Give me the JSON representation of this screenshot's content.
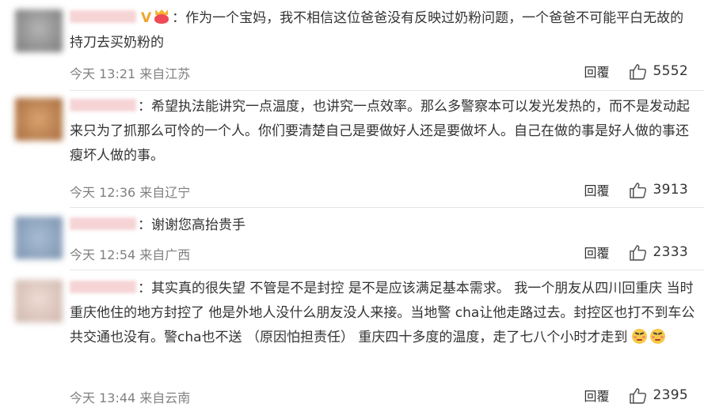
{
  "comments": [
    {
      "avatar_color": "#8f8f8f",
      "text": "：作为一个宝妈，我不相信这位爸爸没有反映过奶粉问题，一个爸爸不可能平白无故的持刀去买奶粉的",
      "time": "今天 13:21 来自江苏",
      "reply_label": "回覆",
      "likes": "5552",
      "badges": {
        "verified": "V",
        "crown": "crown-face-badge-icon"
      }
    },
    {
      "avatar_color": "#c98a55",
      "text": "：希望执法能讲究一点温度，也讲究一点效率。那么多警察本可以发光发热的，而不是发动起来只为了抓那么可怜的一个人。你们要清楚自己是要做好人还是要做坏人。自己在做的事是好人做的事还瘦坏人做的事。",
      "time": "今天 12:36 来自辽宁",
      "reply_label": "回覆",
      "likes": "3913"
    },
    {
      "avatar_color": "#8fa7c2",
      "text": "：谢谢您高抬贵手",
      "time": "今天 12:54 来自广西",
      "reply_label": "回覆",
      "likes": "2333"
    },
    {
      "avatar_color": "#e2cdc6",
      "text": "：其实真的很失望 不管是不是封控 是不是应该满足基本需求。 我一个朋友从四川回重庆 当时重庆他住的地方封控了 他是外地人没什么朋友没人来接。当地警 cha让他走路过去。封控区也打不到车公共交通也没有。警cha也不送 （原因怕担责任） 重庆四十多度的温度，走了七八个小时才走到",
      "emojis": [
        "sad-emoji-icon",
        "sad-emoji-icon"
      ],
      "time": "今天 13:44 来自云南",
      "reply_label": "回覆",
      "likes": "2395"
    }
  ],
  "colors": {
    "text": "#333333",
    "meta": "#808080",
    "divider": "#e6e6e6",
    "username_blur": "#f6d4d6",
    "verified_badge": "#f0a42a"
  }
}
